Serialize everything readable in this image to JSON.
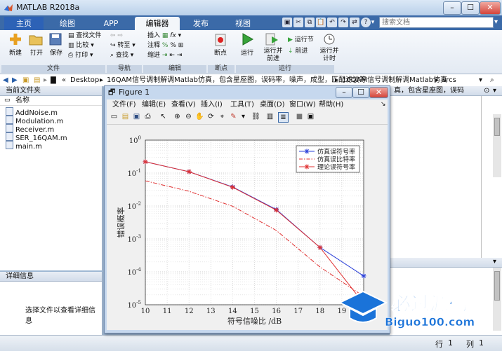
{
  "window": {
    "title": "MATLAB R2018a"
  },
  "ribbon_tabs": [
    "主页",
    "绘图",
    "APP",
    "编辑器",
    "发布",
    "视图"
  ],
  "search": {
    "placeholder": "搜索文档"
  },
  "ribbon": {
    "file_group": {
      "new": "新建",
      "open": "打开",
      "save": "保存",
      "find_files": "查找文件",
      "compare": "比较",
      "print": "打印",
      "label": "文件"
    },
    "nav_group": {
      "goto": "转至",
      "find": "查找",
      "label": "导航"
    },
    "edit_group": {
      "insert": "插入",
      "comment": "注释",
      "indent": "缩进",
      "label": "编辑"
    },
    "breakpoint_group": {
      "breakpoints": "断点",
      "label": "断点"
    },
    "run_group": {
      "run": "运行",
      "run_advance": "运行并\n前进",
      "run_section": "运行节",
      "advance": "前进",
      "run_time": "运行并\n计时",
      "label": "运行"
    }
  },
  "address": {
    "parts": [
      "Desktop",
      "16QAM信号调制解调Matlab仿真，包含星座图，误码率，噪声，成型，匹配滤波等",
      "16QAM信号调制解调Matlab仿真",
      "srcs"
    ]
  },
  "current_folder": {
    "title": "当前文件夹",
    "column": "名称",
    "files": [
      "AddNoise.m",
      "Modulation.m",
      "Receiver.m",
      "SER_16QAM.m",
      "main.m"
    ]
  },
  "details": {
    "title": "详细信息",
    "message": "选择文件以查看详细信息"
  },
  "right_overflow_text": "真，包含星座图，误码",
  "status": {
    "row_label": "行",
    "row_value": "1",
    "col_label": "列",
    "col_value": "1"
  },
  "figure": {
    "title": "Figure 1",
    "menu": [
      "文件(F)",
      "编辑(E)",
      "查看(V)",
      "插入(I)",
      "工具(T)",
      "桌面(D)",
      "窗口(W)",
      "帮助(H)"
    ]
  },
  "chart_data": {
    "type": "line",
    "title": "",
    "xlabel": "符号信噪比 /dB",
    "ylabel": "错误概率",
    "xlim": [
      10,
      20
    ],
    "ylim": [
      1e-05,
      1
    ],
    "yscale": "log",
    "x_ticks": [
      10,
      11,
      12,
      13,
      14,
      15,
      16,
      17,
      18,
      19,
      20
    ],
    "y_tick_exponents": [
      0,
      -1,
      -2,
      -3,
      -4,
      -5
    ],
    "grid": true,
    "legend_position": "top-right",
    "series": [
      {
        "name": "仿真误符号率",
        "color": "#2a3fd8",
        "style": "solid",
        "marker": "star",
        "x": [
          10,
          12,
          14,
          16,
          18,
          20
        ],
        "y": [
          0.22,
          0.11,
          0.038,
          0.0078,
          0.00055,
          7.5e-05
        ]
      },
      {
        "name": "仿真误比特率",
        "color": "#e03030",
        "style": "dashdot",
        "marker": "none",
        "x": [
          10,
          12,
          14,
          16,
          18,
          20
        ],
        "y": [
          0.058,
          0.028,
          0.0098,
          0.0018,
          0.00014,
          1.8e-05
        ]
      },
      {
        "name": "理论误符号率",
        "color": "#e03030",
        "style": "solid",
        "marker": "star",
        "x": [
          10,
          12,
          14,
          16,
          18,
          20
        ],
        "y": [
          0.22,
          0.11,
          0.037,
          0.0075,
          0.00055,
          1.1e-05
        ]
      }
    ]
  },
  "watermark": {
    "text": "必过源码",
    "url": "Biguo100.com"
  }
}
